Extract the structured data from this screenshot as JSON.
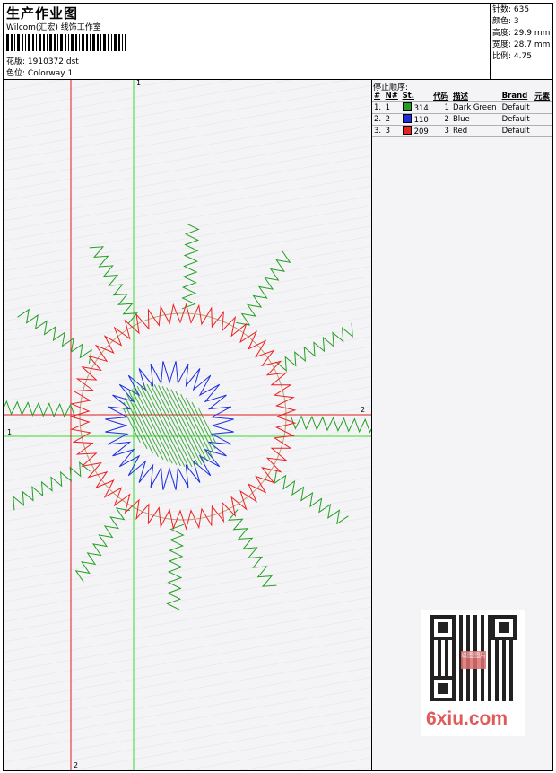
{
  "header": {
    "title": "生产作业图",
    "company": "Wilcom(汇宏) 线饰工作室",
    "design_label": "花版:",
    "design_file": "1910372.dst",
    "colorway_label": "色位:",
    "colorway": "Colorway 1"
  },
  "stats": [
    {
      "label": "针数:",
      "value": "635"
    },
    {
      "label": "颜色:",
      "value": "3"
    },
    {
      "label": "高度:",
      "value": "29.9 mm"
    },
    {
      "label": "宽度:",
      "value": "28.7 mm"
    },
    {
      "label": "比例:",
      "value": "4.75"
    }
  ],
  "stop_sequence": {
    "title": "停止顺序:",
    "columns": [
      "#",
      "N#",
      "St.",
      "代码",
      "描述",
      "Brand",
      "元素"
    ],
    "rows": [
      {
        "idx": "1.",
        "n": "1",
        "color": "#22a022",
        "st": "314",
        "code": "1",
        "desc": "Dark Green",
        "brand": "Default",
        "element": ""
      },
      {
        "idx": "2.",
        "n": "2",
        "color": "#1a2ee0",
        "st": "110",
        "code": "2",
        "desc": "Blue",
        "brand": "Default",
        "element": ""
      },
      {
        "idx": "3.",
        "n": "3",
        "color": "#ee2020",
        "st": "209",
        "code": "3",
        "desc": "Red",
        "brand": "Default",
        "element": ""
      }
    ]
  },
  "axis_labels": {
    "green_v": "1",
    "green_h": "1",
    "red_h": "2",
    "red_v": "2"
  },
  "watermark": "6xiu.com",
  "qr_badge": "以图图片",
  "colors": {
    "green": "#22a022",
    "blue": "#1a2ee0",
    "red": "#ee2020",
    "axis_green": "#33dd33",
    "axis_red": "#dd2222"
  }
}
